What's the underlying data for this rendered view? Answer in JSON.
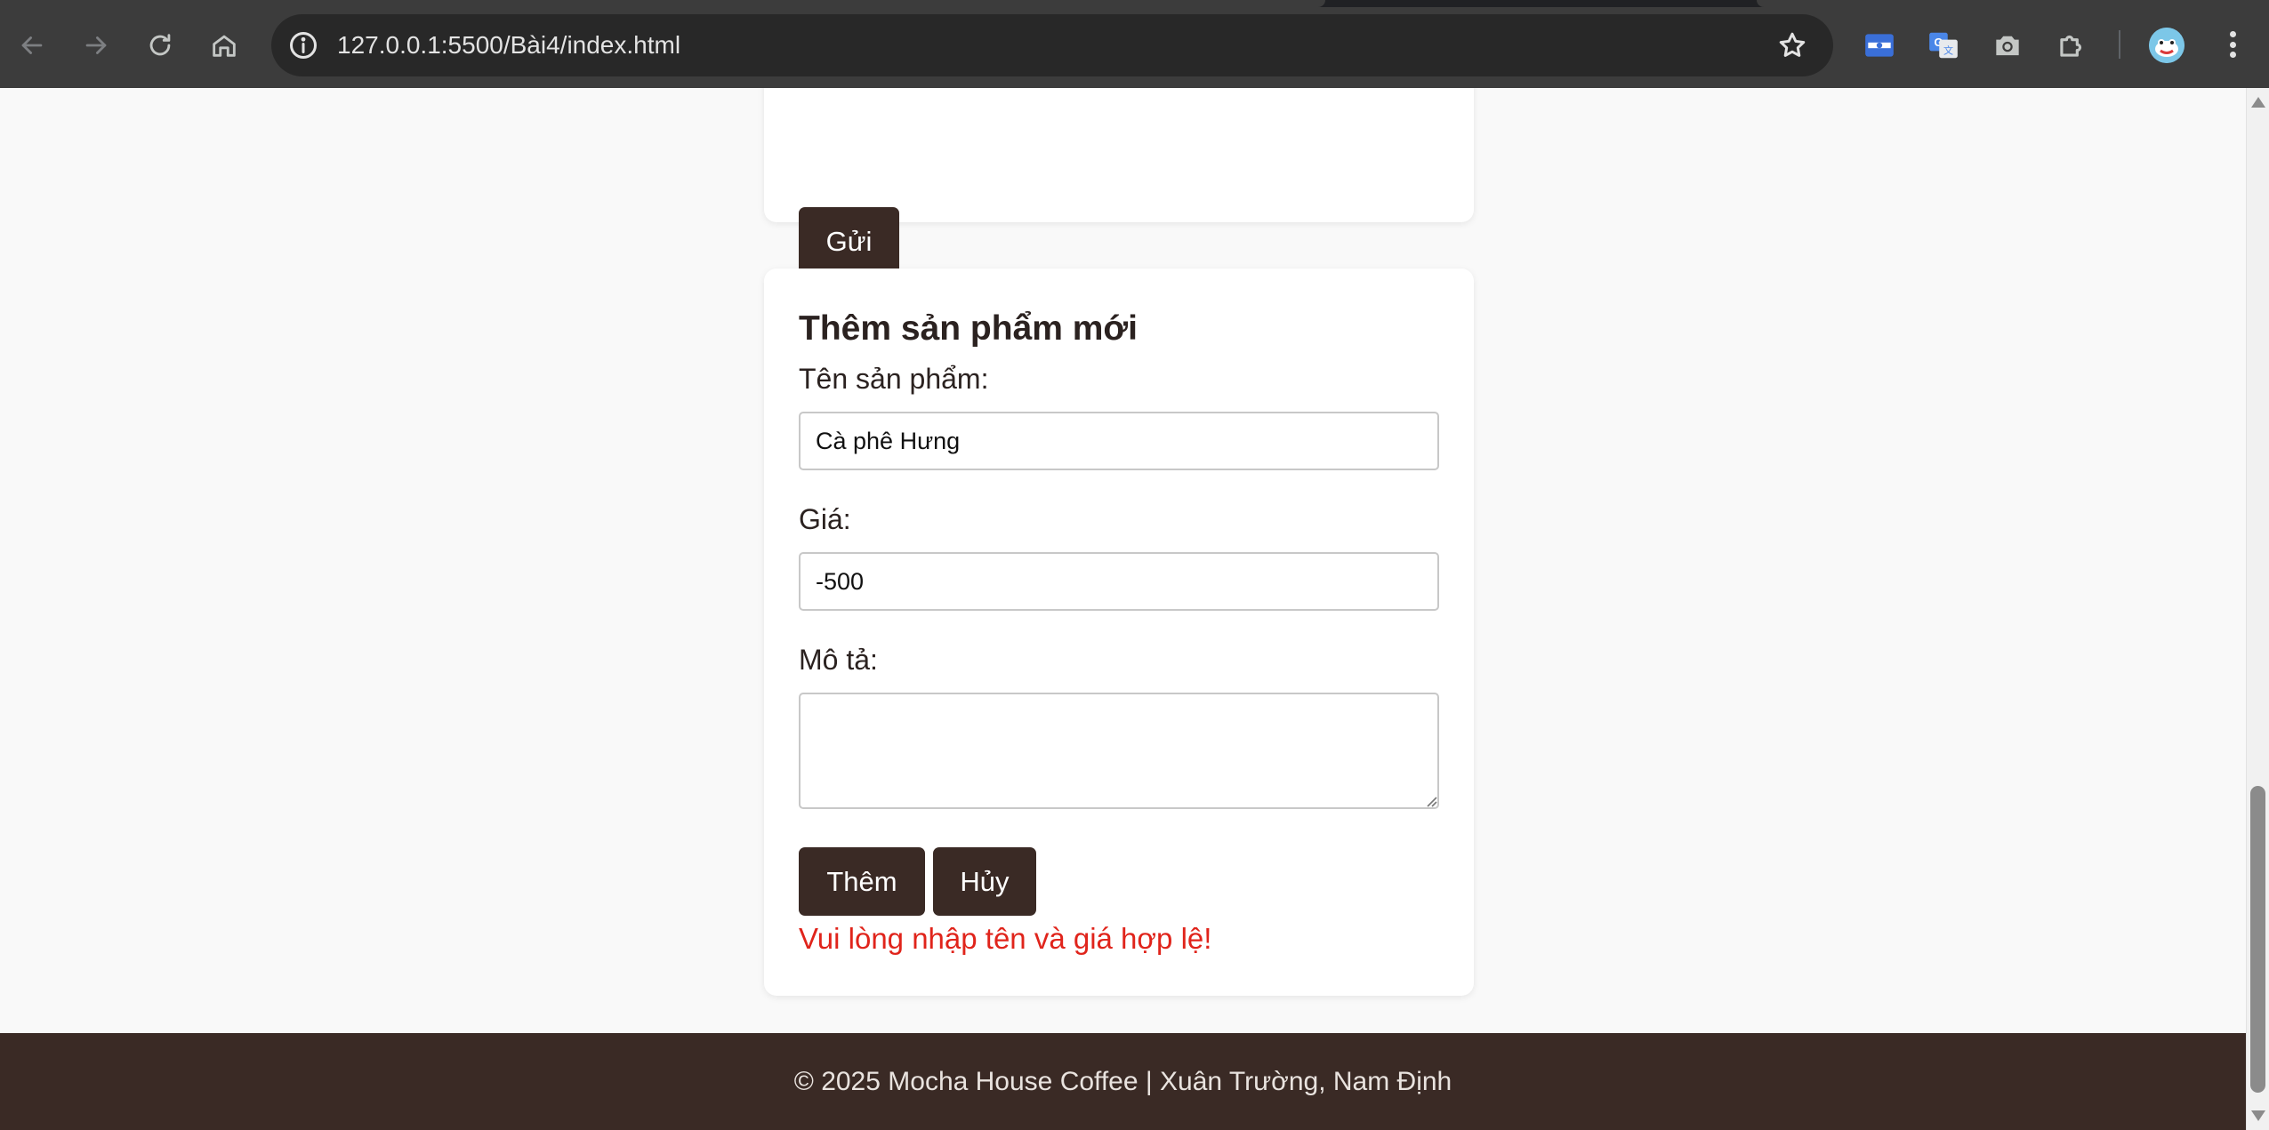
{
  "browser": {
    "url": "127.0.0.1:5500/Bài4/index.html",
    "back_icon": "arrow-left-icon",
    "forward_icon": "arrow-right-icon",
    "reload_icon": "reload-icon",
    "home_icon": "home-icon",
    "site_info_icon": "info-icon",
    "bookmark_icon": "star-icon",
    "extensions": [
      "card-extension-icon",
      "translate-icon",
      "camera-icon",
      "puzzle-icon"
    ],
    "menu_icon": "kebab-menu-icon"
  },
  "top_form": {
    "submit_label": "Gửi"
  },
  "product_form": {
    "title": "Thêm sản phẩm mới",
    "name_label": "Tên sản phẩm:",
    "name_value": "Cà phê Hưng",
    "price_label": "Giá:",
    "price_value": "-500",
    "description_label": "Mô tả:",
    "description_value": "",
    "add_label": "Thêm",
    "cancel_label": "Hủy",
    "error_message": "Vui lòng nhập tên và giá hợp lệ!",
    "error_color": "#e0241b",
    "button_color": "#3a2a25"
  },
  "footer": {
    "text": "© 2025 Mocha House Coffee | Xuân Trường, Nam Định"
  }
}
